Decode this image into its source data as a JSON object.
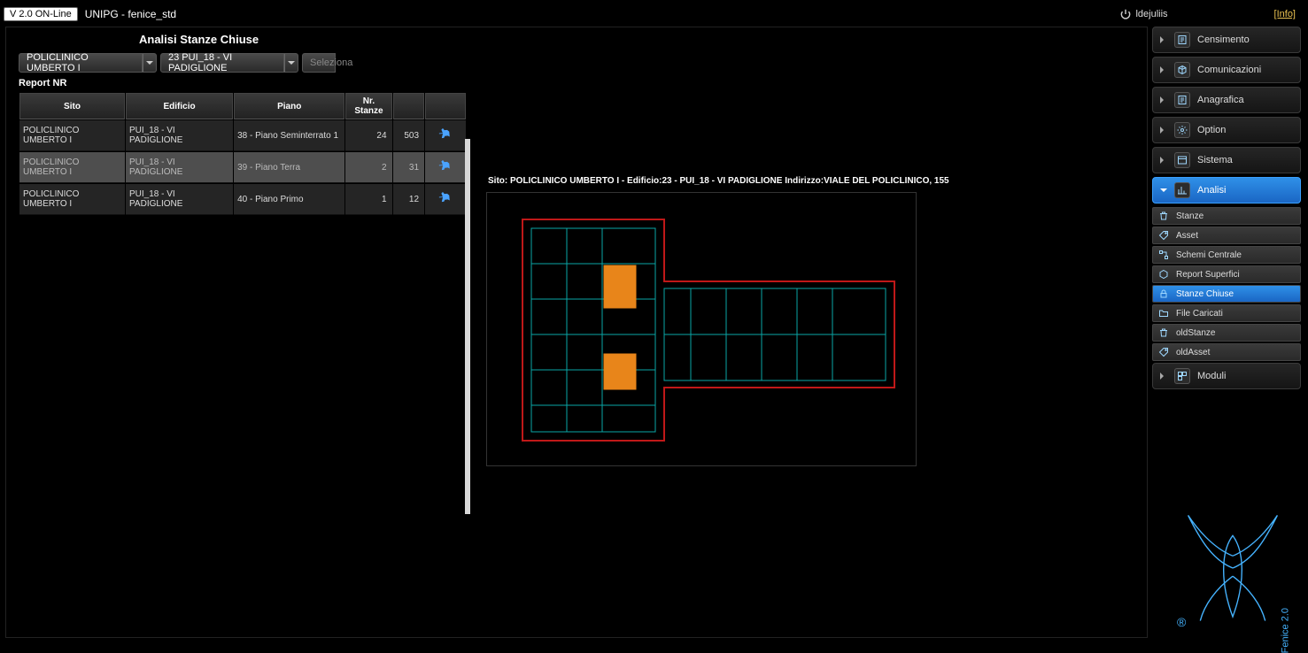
{
  "topbar": {
    "version": "V 2.0 ON-Line",
    "app_title": "UNIPG - fenice_std",
    "user": "ldejuliis",
    "info": "[Info]"
  },
  "page": {
    "title": "Analisi Stanze Chiuse",
    "report_label": "Report NR"
  },
  "selectors": {
    "sito": "POLICLINICO UMBERTO I",
    "edificio": "23 PUI_18 - VI PADIGLIONE",
    "piano_placeholder": "Seleziona"
  },
  "grid": {
    "headers": [
      "Sito",
      "Edificio",
      "Piano",
      "Nr. Stanze",
      "",
      ""
    ],
    "rows": [
      {
        "sito": "POLICLINICO UMBERTO I",
        "edificio": "PUI_18 - VI PADIGLIONE",
        "piano": "38 - Piano Seminterrato 1",
        "nr": "24",
        "extra": "503",
        "selected": false
      },
      {
        "sito": "POLICLINICO UMBERTO I",
        "edificio": "PUI_18 - VI PADIGLIONE",
        "piano": "39 - Piano Terra",
        "nr": "2",
        "extra": "31",
        "selected": true
      },
      {
        "sito": "POLICLINICO UMBERTO I",
        "edificio": "PUI_18 - VI PADIGLIONE",
        "piano": "40 - Piano Primo",
        "nr": "1",
        "extra": "12",
        "selected": false
      }
    ]
  },
  "map": {
    "header": "Sito: POLICLINICO UMBERTO I - Edificio:23 - PUI_18 - VI PADIGLIONE Indirizzo:VIALE DEL POLICLINICO, 155"
  },
  "nav": {
    "sections": [
      {
        "label": "Censimento",
        "icon": "form-icon"
      },
      {
        "label": "Comunicazioni",
        "icon": "cube-icon"
      },
      {
        "label": "Anagrafica",
        "icon": "form-icon"
      },
      {
        "label": "Option",
        "icon": "gears-icon"
      },
      {
        "label": "Sistema",
        "icon": "window-icon"
      },
      {
        "label": "Analisi",
        "icon": "chart-icon",
        "active": true
      },
      {
        "label": "Moduli",
        "icon": "module-icon"
      }
    ],
    "analisi_sub": [
      {
        "label": "Stanze",
        "icon": "trash-icon"
      },
      {
        "label": "Asset",
        "icon": "tag-icon"
      },
      {
        "label": "Schemi Centrale",
        "icon": "schema-icon"
      },
      {
        "label": "Report Superfici",
        "icon": "hex-icon"
      },
      {
        "label": "Stanze Chiuse",
        "icon": "lock-icon",
        "active": true
      },
      {
        "label": "File Caricati",
        "icon": "folder-icon"
      },
      {
        "label": "oldStanze",
        "icon": "trash-icon"
      },
      {
        "label": "oldAsset",
        "icon": "tag-icon"
      }
    ]
  },
  "logo": {
    "brand": "Fenice 2.0",
    "reg": "®"
  }
}
